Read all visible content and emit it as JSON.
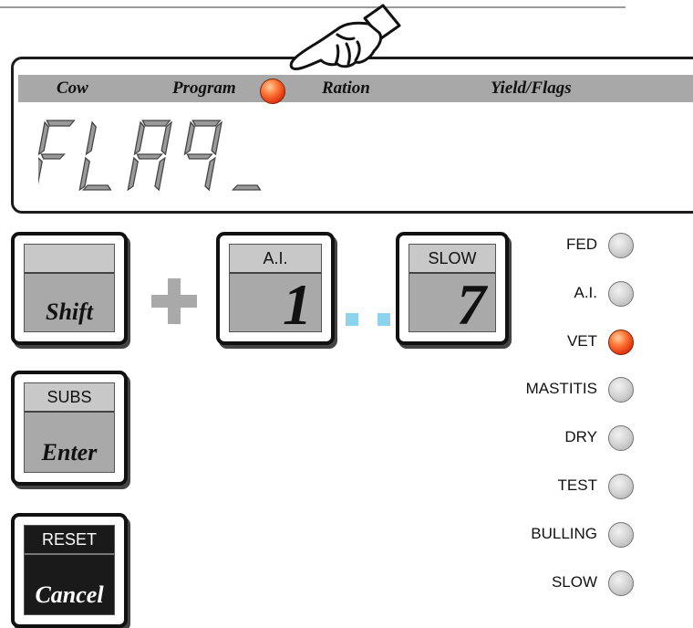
{
  "display": {
    "modes": [
      "Cow",
      "Program",
      "Ration",
      "Yield/Flags"
    ],
    "active_mode": "Program",
    "lcd_text": "FLAG_"
  },
  "keys": {
    "shift": {
      "top": "",
      "bottom": "Shift"
    },
    "ai": {
      "top": "A.I.",
      "bottom": "1"
    },
    "slow": {
      "top": "SLOW",
      "bottom": "7"
    },
    "enter": {
      "top": "SUBS",
      "bottom": "Enter"
    },
    "cancel": {
      "top": "RESET",
      "bottom": "Cancel"
    }
  },
  "flags": [
    {
      "label": "FED",
      "on": false
    },
    {
      "label": "A.I.",
      "on": false
    },
    {
      "label": "VET",
      "on": true
    },
    {
      "label": "MASTITIS",
      "on": false
    },
    {
      "label": "DRY",
      "on": false
    },
    {
      "label": "TEST",
      "on": false
    },
    {
      "label": "BULLING",
      "on": false
    },
    {
      "label": "SLOW",
      "on": false
    }
  ],
  "colors": {
    "led_on": "#e0300c",
    "led_off": "#cfcfcf",
    "mode_bar": "#a8a8a8",
    "dash": "#8dd3ee"
  },
  "icons": {
    "pointer": "pointing-hand-icon"
  }
}
